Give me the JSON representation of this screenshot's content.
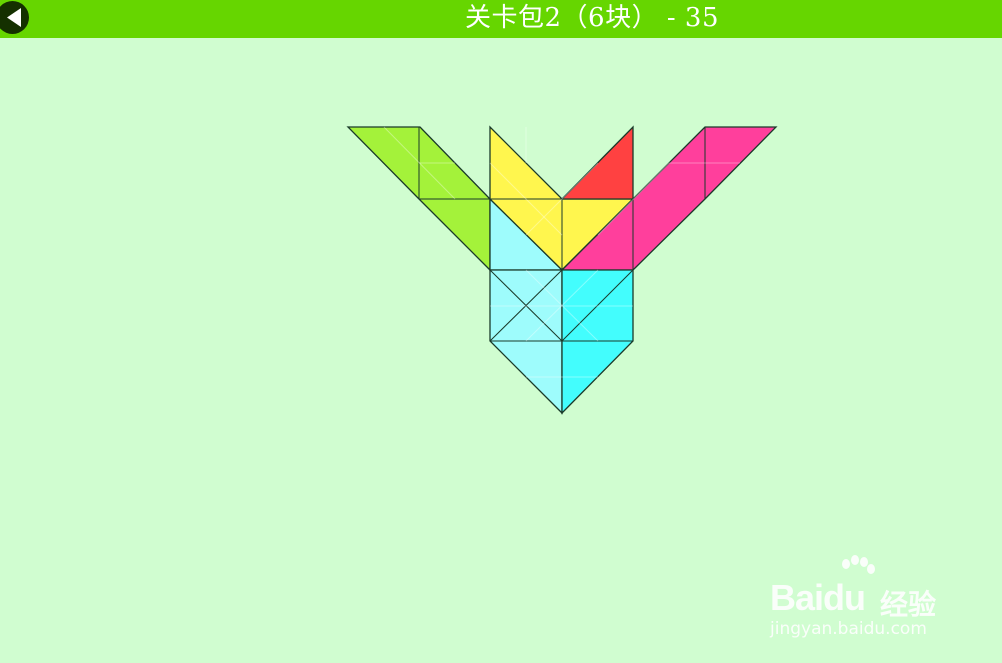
{
  "header": {
    "title": "关卡包2（6块） - 35",
    "back_icon": "back-arrow-icon",
    "bar_color": "#66d600"
  },
  "puzzle": {
    "pieces": [
      {
        "name": "lime",
        "color": "#a4f23a"
      },
      {
        "name": "yellow",
        "color": "#fff64e"
      },
      {
        "name": "red",
        "color": "#ff4141"
      },
      {
        "name": "magenta",
        "color": "#ff3f9c"
      },
      {
        "name": "light-cyan",
        "color": "#9efcfc"
      },
      {
        "name": "cyan",
        "color": "#43fdfd"
      }
    ],
    "board_color": "#d0fdd0"
  },
  "watermark": {
    "brand": "Baidu",
    "sub": "经验",
    "url": "jingyan.baidu.com"
  }
}
